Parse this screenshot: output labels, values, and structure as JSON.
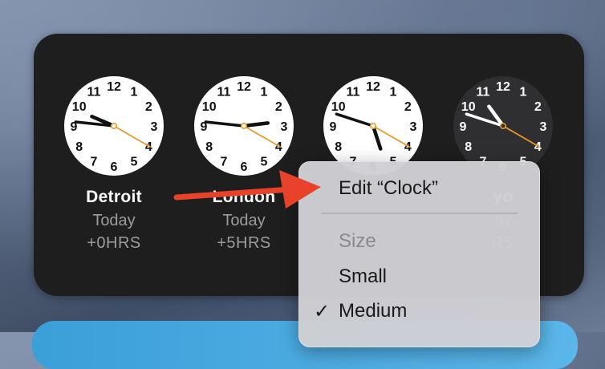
{
  "widget": {
    "clocks": [
      {
        "city": "Detroit",
        "day": "Today",
        "offset": "+0HRS",
        "theme": "light",
        "hour": 9.77,
        "minute": 46,
        "second": 20
      },
      {
        "city": "London",
        "day": "Today",
        "offset": "+5HRS",
        "theme": "light",
        "hour": 2.77,
        "minute": 46,
        "second": 20
      },
      {
        "city": "",
        "day": "",
        "offset": "",
        "theme": "light",
        "hour": 5.4,
        "minute": 48,
        "second": 20
      },
      {
        "city": "yo",
        "day": "ay",
        "offset": "RS",
        "theme": "dark",
        "hour": 10.8,
        "minute": 48,
        "second": 20
      }
    ],
    "numerals": [
      "12",
      "1",
      "2",
      "3",
      "4",
      "5",
      "6",
      "7",
      "8",
      "9",
      "10",
      "11"
    ]
  },
  "context_menu": {
    "edit_label": "Edit “Clock”",
    "size_header": "Size",
    "small_label": "Small",
    "medium_label": "Medium",
    "checkmark": "✓"
  },
  "colors": {
    "widget_bg": "#1e1e1f",
    "second_hand": "#e89b2a",
    "arrow": "#e8432a",
    "menu_bg": "#cfd0d4"
  }
}
